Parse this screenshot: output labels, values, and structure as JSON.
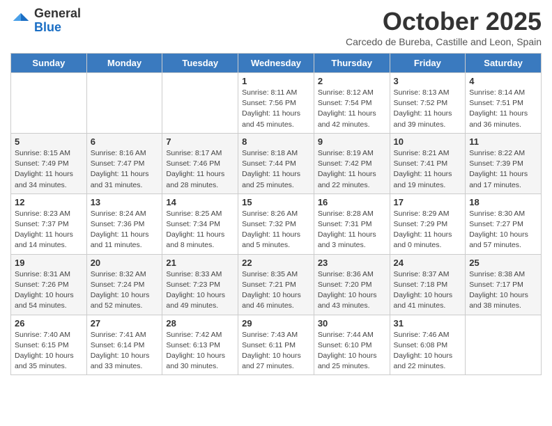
{
  "header": {
    "logo_general": "General",
    "logo_blue": "Blue",
    "month_title": "October 2025",
    "subtitle": "Carcedo de Bureba, Castille and Leon, Spain"
  },
  "weekdays": [
    "Sunday",
    "Monday",
    "Tuesday",
    "Wednesday",
    "Thursday",
    "Friday",
    "Saturday"
  ],
  "weeks": [
    [
      {
        "day": "",
        "info": ""
      },
      {
        "day": "",
        "info": ""
      },
      {
        "day": "",
        "info": ""
      },
      {
        "day": "1",
        "info": "Sunrise: 8:11 AM\nSunset: 7:56 PM\nDaylight: 11 hours\nand 45 minutes."
      },
      {
        "day": "2",
        "info": "Sunrise: 8:12 AM\nSunset: 7:54 PM\nDaylight: 11 hours\nand 42 minutes."
      },
      {
        "day": "3",
        "info": "Sunrise: 8:13 AM\nSunset: 7:52 PM\nDaylight: 11 hours\nand 39 minutes."
      },
      {
        "day": "4",
        "info": "Sunrise: 8:14 AM\nSunset: 7:51 PM\nDaylight: 11 hours\nand 36 minutes."
      }
    ],
    [
      {
        "day": "5",
        "info": "Sunrise: 8:15 AM\nSunset: 7:49 PM\nDaylight: 11 hours\nand 34 minutes."
      },
      {
        "day": "6",
        "info": "Sunrise: 8:16 AM\nSunset: 7:47 PM\nDaylight: 11 hours\nand 31 minutes."
      },
      {
        "day": "7",
        "info": "Sunrise: 8:17 AM\nSunset: 7:46 PM\nDaylight: 11 hours\nand 28 minutes."
      },
      {
        "day": "8",
        "info": "Sunrise: 8:18 AM\nSunset: 7:44 PM\nDaylight: 11 hours\nand 25 minutes."
      },
      {
        "day": "9",
        "info": "Sunrise: 8:19 AM\nSunset: 7:42 PM\nDaylight: 11 hours\nand 22 minutes."
      },
      {
        "day": "10",
        "info": "Sunrise: 8:21 AM\nSunset: 7:41 PM\nDaylight: 11 hours\nand 19 minutes."
      },
      {
        "day": "11",
        "info": "Sunrise: 8:22 AM\nSunset: 7:39 PM\nDaylight: 11 hours\nand 17 minutes."
      }
    ],
    [
      {
        "day": "12",
        "info": "Sunrise: 8:23 AM\nSunset: 7:37 PM\nDaylight: 11 hours\nand 14 minutes."
      },
      {
        "day": "13",
        "info": "Sunrise: 8:24 AM\nSunset: 7:36 PM\nDaylight: 11 hours\nand 11 minutes."
      },
      {
        "day": "14",
        "info": "Sunrise: 8:25 AM\nSunset: 7:34 PM\nDaylight: 11 hours\nand 8 minutes."
      },
      {
        "day": "15",
        "info": "Sunrise: 8:26 AM\nSunset: 7:32 PM\nDaylight: 11 hours\nand 5 minutes."
      },
      {
        "day": "16",
        "info": "Sunrise: 8:28 AM\nSunset: 7:31 PM\nDaylight: 11 hours\nand 3 minutes."
      },
      {
        "day": "17",
        "info": "Sunrise: 8:29 AM\nSunset: 7:29 PM\nDaylight: 11 hours\nand 0 minutes."
      },
      {
        "day": "18",
        "info": "Sunrise: 8:30 AM\nSunset: 7:27 PM\nDaylight: 10 hours\nand 57 minutes."
      }
    ],
    [
      {
        "day": "19",
        "info": "Sunrise: 8:31 AM\nSunset: 7:26 PM\nDaylight: 10 hours\nand 54 minutes."
      },
      {
        "day": "20",
        "info": "Sunrise: 8:32 AM\nSunset: 7:24 PM\nDaylight: 10 hours\nand 52 minutes."
      },
      {
        "day": "21",
        "info": "Sunrise: 8:33 AM\nSunset: 7:23 PM\nDaylight: 10 hours\nand 49 minutes."
      },
      {
        "day": "22",
        "info": "Sunrise: 8:35 AM\nSunset: 7:21 PM\nDaylight: 10 hours\nand 46 minutes."
      },
      {
        "day": "23",
        "info": "Sunrise: 8:36 AM\nSunset: 7:20 PM\nDaylight: 10 hours\nand 43 minutes."
      },
      {
        "day": "24",
        "info": "Sunrise: 8:37 AM\nSunset: 7:18 PM\nDaylight: 10 hours\nand 41 minutes."
      },
      {
        "day": "25",
        "info": "Sunrise: 8:38 AM\nSunset: 7:17 PM\nDaylight: 10 hours\nand 38 minutes."
      }
    ],
    [
      {
        "day": "26",
        "info": "Sunrise: 7:40 AM\nSunset: 6:15 PM\nDaylight: 10 hours\nand 35 minutes."
      },
      {
        "day": "27",
        "info": "Sunrise: 7:41 AM\nSunset: 6:14 PM\nDaylight: 10 hours\nand 33 minutes."
      },
      {
        "day": "28",
        "info": "Sunrise: 7:42 AM\nSunset: 6:13 PM\nDaylight: 10 hours\nand 30 minutes."
      },
      {
        "day": "29",
        "info": "Sunrise: 7:43 AM\nSunset: 6:11 PM\nDaylight: 10 hours\nand 27 minutes."
      },
      {
        "day": "30",
        "info": "Sunrise: 7:44 AM\nSunset: 6:10 PM\nDaylight: 10 hours\nand 25 minutes."
      },
      {
        "day": "31",
        "info": "Sunrise: 7:46 AM\nSunset: 6:08 PM\nDaylight: 10 hours\nand 22 minutes."
      },
      {
        "day": "",
        "info": ""
      }
    ]
  ]
}
